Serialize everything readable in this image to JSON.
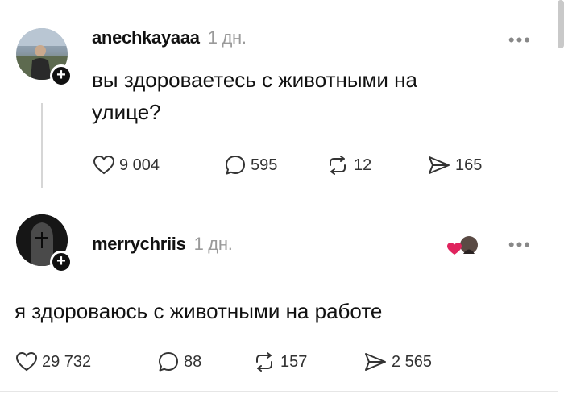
{
  "posts": [
    {
      "username": "anechkayaaa",
      "time": "1 дн.",
      "text": "вы здороваетесь с животными на улице?",
      "likes": "9 004",
      "replies": "595",
      "reposts": "12",
      "shares": "165"
    },
    {
      "username": "merrychriis",
      "time": "1 дн.",
      "text": "я здороваюсь с животными на работе",
      "likes": "29 732",
      "replies": "88",
      "reposts": "157",
      "shares": "2 565"
    }
  ],
  "icons": {
    "heart": "heart-icon",
    "reply": "reply-icon",
    "repost": "repost-icon",
    "share": "share-icon",
    "more": "more-icon",
    "follow": "plus-icon"
  },
  "colors": {
    "like_accent": "#e0245e"
  }
}
